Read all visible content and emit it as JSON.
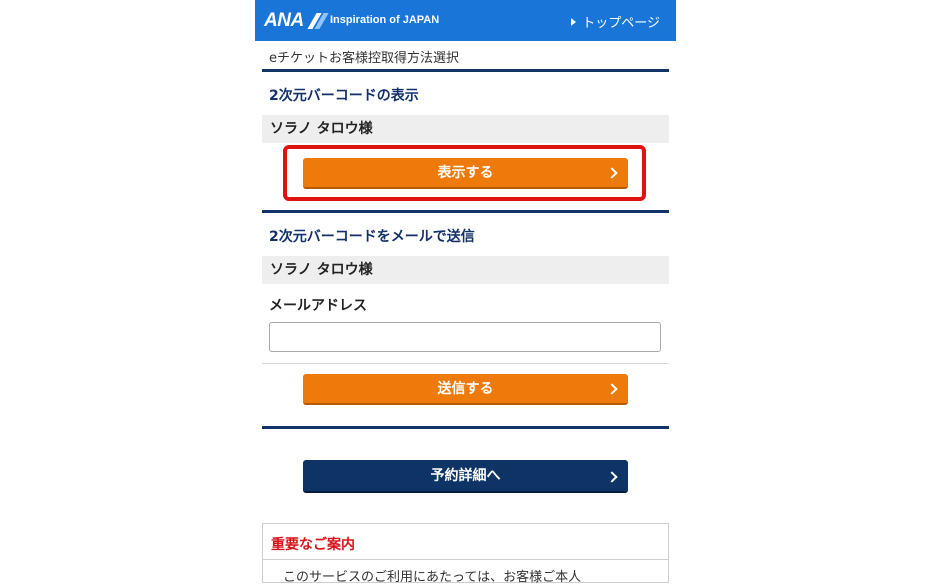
{
  "header": {
    "logo": "ANA",
    "tagline": "Inspiration of JAPAN",
    "top_link": "トップページ",
    "colors": {
      "header_bg": "#1a75d8"
    }
  },
  "breadcrumb": "eチケットお客様控取得方法選択",
  "display_section": {
    "title": "2次元バーコードの表示",
    "passenger": "ソラノ タロウ様",
    "button_label": "表示する"
  },
  "email_section": {
    "title": "2次元バーコードをメールで送信",
    "passenger": "ソラノ タロウ様",
    "email_label": "メールアドレス",
    "email_value": "",
    "button_label": "送信する"
  },
  "reservation_button_label": "予約詳細へ",
  "notice": {
    "title": "重要なご案内",
    "text": "このサービスのご利用にあたっては、お客様ご本人"
  },
  "colors": {
    "accent_orange": "#ee7a0c",
    "navy": "#0e3466",
    "highlight_red": "#e01111",
    "notice_red": "#d8141a"
  }
}
